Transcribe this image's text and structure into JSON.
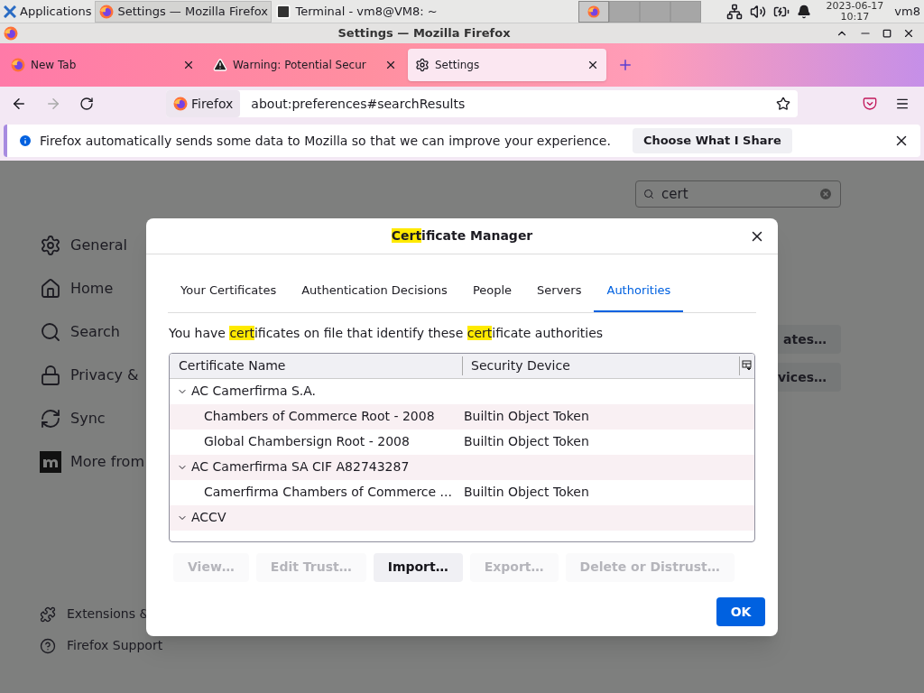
{
  "taskbar": {
    "menu": "Applications",
    "windows": [
      {
        "title": "Settings — Mozilla Firefox",
        "kind": "firefox",
        "selected": true
      },
      {
        "title": "Terminal - vm8@VM8: ~",
        "kind": "terminal",
        "selected": false
      }
    ],
    "date": "2023-06-17",
    "time": "10:17",
    "user": "vm8"
  },
  "window": {
    "title": "Settings — Mozilla Firefox"
  },
  "tabs": [
    {
      "label": "New Tab",
      "kind": "firefox",
      "selected": false
    },
    {
      "label": "Warning: Potential Secur",
      "kind": "warning",
      "selected": false
    },
    {
      "label": "Settings",
      "kind": "settings",
      "selected": true
    }
  ],
  "address_bar": {
    "identity": "Firefox",
    "value": "about:preferences#searchResults"
  },
  "notification": {
    "message": "Firefox automatically sends some data to Mozilla so that we can improve your experience.",
    "button": "Choose What I Share"
  },
  "settings": {
    "search": {
      "value": "cert"
    },
    "sidebar": [
      {
        "label": "General",
        "kind": "gear"
      },
      {
        "label": "Home",
        "kind": "home"
      },
      {
        "label": "Search",
        "kind": "search"
      },
      {
        "label": "Privacy &",
        "kind": "lock"
      },
      {
        "label": "Sync",
        "kind": "sync"
      },
      {
        "label": "More from",
        "kind": "mozilla"
      }
    ],
    "footer_links": [
      {
        "label": "Extensions &",
        "kind": "puzzle"
      },
      {
        "label": "Firefox Support",
        "kind": "help"
      }
    ],
    "buttons": [
      "ates…",
      "vices…"
    ]
  },
  "dialog": {
    "title": [
      {
        "text": "Cert",
        "highlighted": true
      },
      {
        "text": "ificate Manager",
        "highlighted": false
      }
    ],
    "tabs": [
      {
        "label": "Your Certificates",
        "selected": false
      },
      {
        "label": "Authentication Decisions",
        "selected": false
      },
      {
        "label": "People",
        "selected": false
      },
      {
        "label": "Servers",
        "selected": false
      },
      {
        "label": "Authorities",
        "selected": true
      }
    ],
    "description": [
      {
        "text": "You have ",
        "highlighted": false
      },
      {
        "text": "cert",
        "highlighted": true
      },
      {
        "text": "ificates on file that identify these ",
        "highlighted": false
      },
      {
        "text": "cert",
        "highlighted": true
      },
      {
        "text": "ificate authorities",
        "highlighted": false
      }
    ],
    "columns": [
      "Certificate Name",
      "Security Device"
    ],
    "rows": [
      {
        "kind": "group",
        "name": "AC Camerfirma S.A.",
        "expanded": true
      },
      {
        "kind": "cert",
        "name": "Chambers of Commerce Root - 2008",
        "device": "Builtin Object Token"
      },
      {
        "kind": "cert",
        "name": "Global Chambersign Root - 2008",
        "device": "Builtin Object Token"
      },
      {
        "kind": "group",
        "name": "AC Camerfirma SA CIF A82743287",
        "expanded": true
      },
      {
        "kind": "cert",
        "name": "Camerfirma Chambers of Commerce ...",
        "device": "Builtin Object Token"
      },
      {
        "kind": "group",
        "name": "ACCV",
        "expanded": true
      }
    ],
    "actions": [
      {
        "label": "View…",
        "disabled": true
      },
      {
        "label": "Edit Trust…",
        "disabled": true
      },
      {
        "label": "Import…",
        "disabled": false
      },
      {
        "label": "Export…",
        "disabled": true
      },
      {
        "label": "Delete or Distrust…",
        "disabled": true
      }
    ],
    "ok": "OK"
  }
}
